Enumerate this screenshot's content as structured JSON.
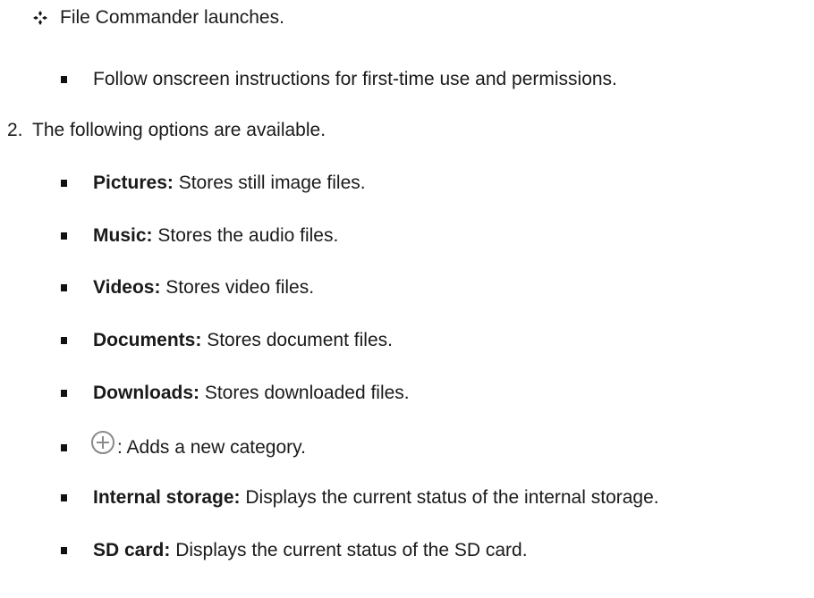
{
  "doc": {
    "step1_result": "File Commander launches.",
    "step1_sub": "Follow onscreen instructions for first-time use and permissions.",
    "step2_number": "2.",
    "step2_text": "The following options are available.",
    "options": [
      {
        "term": "Pictures:",
        "desc": " Stores still image files."
      },
      {
        "term": "Music:",
        "desc": " Stores the audio files."
      },
      {
        "term": "Videos:",
        "desc": " Stores video files."
      },
      {
        "term": "Documents:",
        "desc": " Stores document files."
      },
      {
        "term": "Downloads:",
        "desc": " Stores downloaded files."
      }
    ],
    "add_category_icon": "circle-plus-icon",
    "add_category_desc": ": Adds a new category.",
    "storage": [
      {
        "term": "Internal storage:",
        "desc": " Displays the current status of the internal storage."
      },
      {
        "term": "SD card:",
        "desc": " Displays the current status of the SD card."
      }
    ]
  }
}
